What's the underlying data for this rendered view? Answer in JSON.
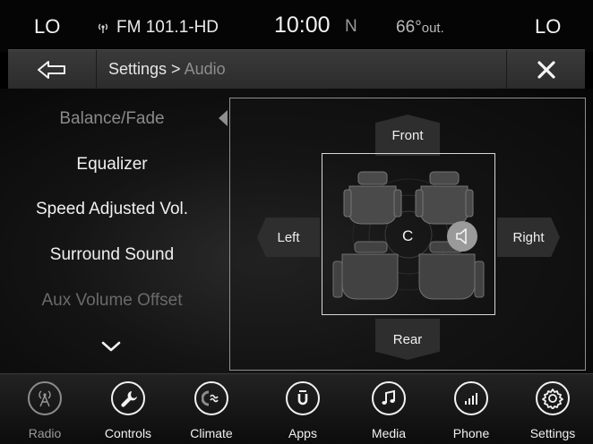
{
  "status": {
    "left_zone": "LO",
    "right_zone": "LO",
    "station": "FM 101.1-HD",
    "time": "10:00",
    "compass": "N",
    "temperature": "66°",
    "temperature_suffix": "out."
  },
  "header": {
    "breadcrumb_parent": "Settings >",
    "breadcrumb_current": "Audio"
  },
  "menu": {
    "items": [
      {
        "label": "Balance/Fade"
      },
      {
        "label": "Equalizer"
      },
      {
        "label": "Speed Adjusted Vol."
      },
      {
        "label": "Surround Sound"
      },
      {
        "label": "Aux Volume Offset"
      }
    ]
  },
  "balance": {
    "front": "Front",
    "rear": "Rear",
    "left": "Left",
    "right": "Right",
    "center": "C"
  },
  "nav": {
    "items": [
      {
        "label": "Radio",
        "icon": "radio-tower-icon"
      },
      {
        "label": "Controls",
        "icon": "wrench-icon"
      },
      {
        "label": "Climate",
        "icon": "climate-icon"
      },
      {
        "label": "Apps",
        "icon": "uconnect-icon"
      },
      {
        "label": "Media",
        "icon": "music-note-icon"
      },
      {
        "label": "Phone",
        "icon": "phone-signal-icon"
      },
      {
        "label": "Settings",
        "icon": "gear-icon"
      }
    ]
  },
  "colors": {
    "background": "#000000",
    "header": "#333333",
    "accent_text": "#f0f0f0",
    "dim_text": "#8e8e8e"
  }
}
